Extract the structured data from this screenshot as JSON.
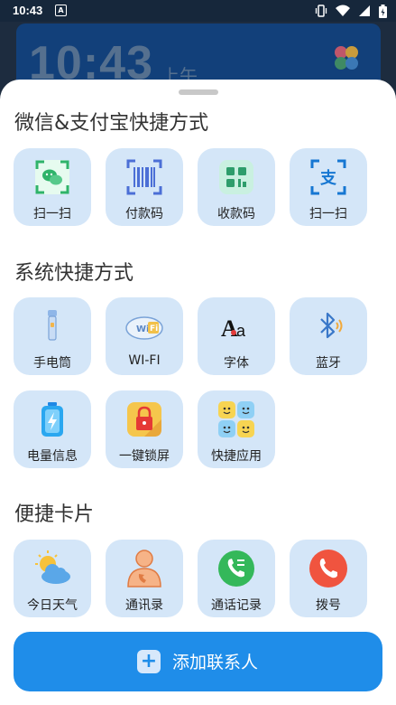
{
  "status_bar": {
    "time": "10:43",
    "notification_icon": "A",
    "icons": [
      "vibrate-icon",
      "wifi-icon",
      "signal-icon",
      "battery-icon"
    ]
  },
  "wallpaper": {
    "clock": "10:43",
    "period": "上午"
  },
  "sections": {
    "payment": {
      "title": "微信&支付宝快捷方式",
      "items": [
        {
          "label": "扫一扫",
          "icon": "wechat-scan-icon"
        },
        {
          "label": "付款码",
          "icon": "barcode-icon"
        },
        {
          "label": "收款码",
          "icon": "qr-receive-icon"
        },
        {
          "label": "扫一扫",
          "icon": "alipay-scan-icon"
        }
      ]
    },
    "system": {
      "title": "系统快捷方式",
      "items": [
        {
          "label": "手电筒",
          "icon": "flashlight-icon"
        },
        {
          "label": "WI-FI",
          "icon": "wifi-cloud-icon"
        },
        {
          "label": "字体",
          "icon": "font-icon",
          "glyph": "Aa"
        },
        {
          "label": "蓝牙",
          "icon": "bluetooth-icon"
        },
        {
          "label": "电量信息",
          "icon": "battery-info-icon"
        },
        {
          "label": "一键锁屏",
          "icon": "lock-screen-icon"
        },
        {
          "label": "快捷应用",
          "icon": "quick-apps-icon"
        }
      ]
    },
    "cards": {
      "title": "便捷卡片",
      "items": [
        {
          "label": "今日天气",
          "icon": "weather-icon"
        },
        {
          "label": "通讯录",
          "icon": "contacts-icon"
        },
        {
          "label": "通话记录",
          "icon": "call-log-icon"
        },
        {
          "label": "拨号",
          "icon": "dial-icon"
        }
      ]
    }
  },
  "cta": {
    "label": "添加联系人",
    "plus": "+"
  },
  "colors": {
    "tile_bg": "#d4e6f8",
    "accent": "#1f8de9",
    "sheet_bg": "#ffffff"
  }
}
